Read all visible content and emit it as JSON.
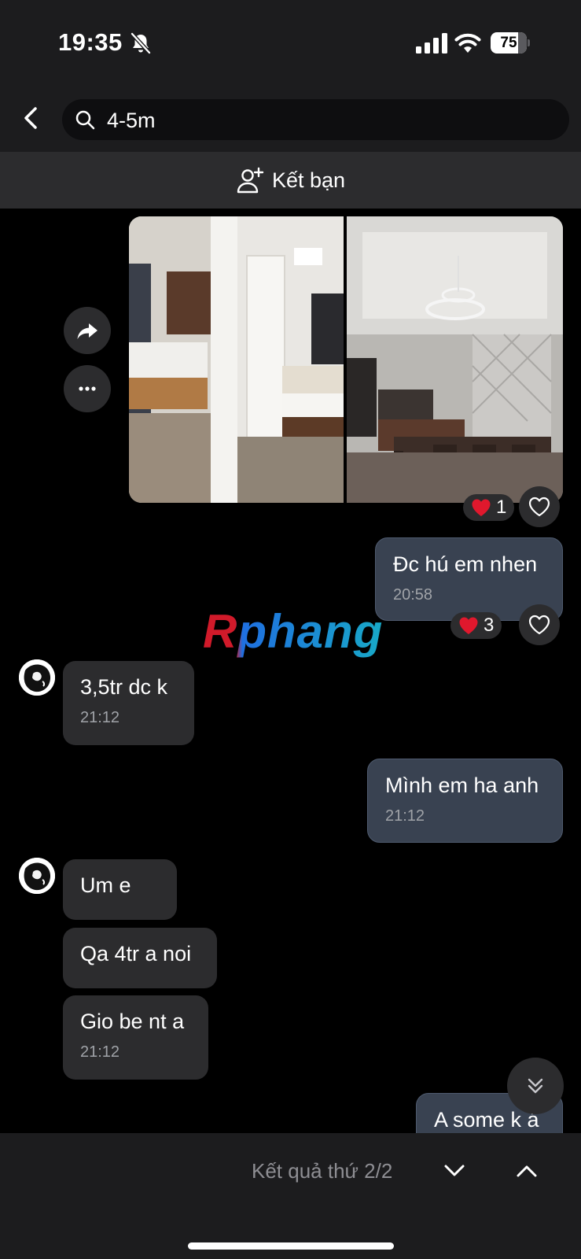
{
  "status_bar": {
    "time": "19:35",
    "battery_level": "75",
    "battery_fraction": 0.75,
    "icons": [
      "bell-slash-icon",
      "cellular-signal-icon",
      "wifi-icon",
      "battery-icon"
    ]
  },
  "header": {
    "back_icon": "chevron-left-icon",
    "search_icon": "search-icon",
    "search_value": "4-5m"
  },
  "friend_bar": {
    "icon": "add-friend-icon",
    "label": "Kết bạn"
  },
  "photo_message": {
    "images": [
      "bedroom-photo",
      "dining-room-photo"
    ],
    "actions": [
      "share-icon",
      "more-icon"
    ],
    "reaction": {
      "emoji": "heart",
      "count": "1"
    }
  },
  "messages": [
    {
      "direction": "outgoing",
      "text": "Đc hú em nhen",
      "time": "20:58",
      "reaction": {
        "emoji": "heart",
        "count": "3"
      }
    },
    {
      "direction": "incoming",
      "text": "3,5tr dc k",
      "time": "21:12"
    },
    {
      "direction": "outgoing",
      "text": "Mình em ha anh",
      "time": "21:12"
    },
    {
      "direction": "incoming",
      "text": "Um e"
    },
    {
      "direction": "incoming",
      "text": "Qa 4tr a noi"
    },
    {
      "direction": "incoming",
      "text": "Gio be nt a",
      "time": "21:12"
    },
    {
      "direction": "outgoing",
      "text": "A some k á"
    }
  ],
  "watermark": "Rphang",
  "footer": {
    "result_text": "Kết quả thứ 2/2",
    "prev_icon": "chevron-down-icon",
    "next_icon": "chevron-up-icon"
  },
  "colors": {
    "background": "#000000",
    "bar": "#1c1c1e",
    "incoming_bubble": "#2c2c2e",
    "outgoing_bubble": "#394251",
    "heart": "#e0182d",
    "watermark_red": "#d11a2a",
    "watermark_blue": "#1f6fe0"
  }
}
